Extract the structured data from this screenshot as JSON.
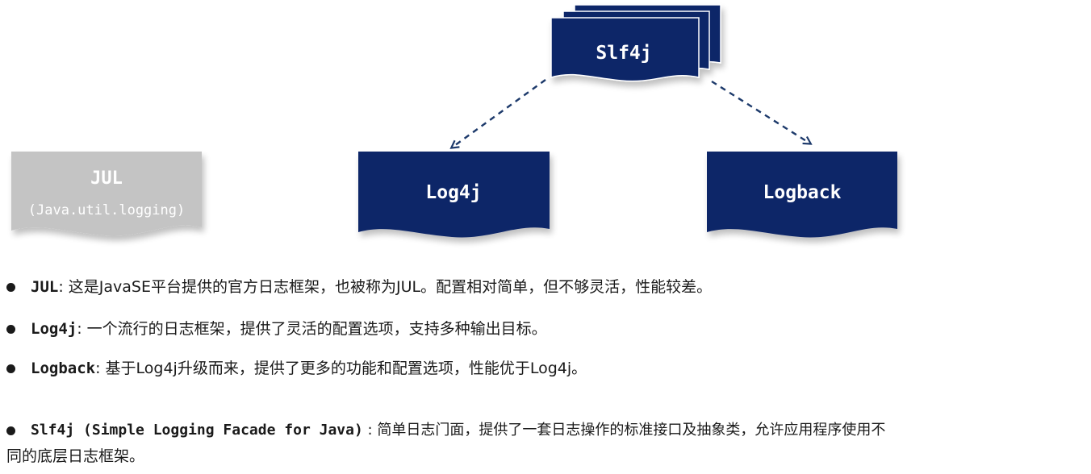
{
  "diagram": {
    "slf4j_label": "Slf4j",
    "jul_title": "JUL",
    "jul_subtitle": "(Java.util.logging)",
    "log4j_label": "Log4j",
    "logback_label": "Logback",
    "colors": {
      "navy": "#0d2568",
      "gray": "#c4c4c4",
      "arrow": "#1d3a6b"
    }
  },
  "bullets": [
    {
      "term": "JUL",
      "sep": ": ",
      "desc": "这是JavaSE平台提供的官方日志框架，也被称为JUL。配置相对简单，但不够灵活，性能较差。"
    },
    {
      "term": "Log4j",
      "sep": ": ",
      "desc": "一个流行的日志框架，提供了灵活的配置选项，支持多种输出目标。"
    },
    {
      "term": "Logback",
      "sep": ": ",
      "desc": "基于Log4j升级而来，提供了更多的功能和配置选项，性能优于Log4j。"
    },
    {
      "term": "Slf4j (Simple Logging Facade for Java)",
      "sep": " : ",
      "desc": "简单日志门面，提供了一套日志操作的标准接口及抽象类，允许应用程序使用不",
      "desc_cont": "同的底层日志框架。"
    }
  ]
}
